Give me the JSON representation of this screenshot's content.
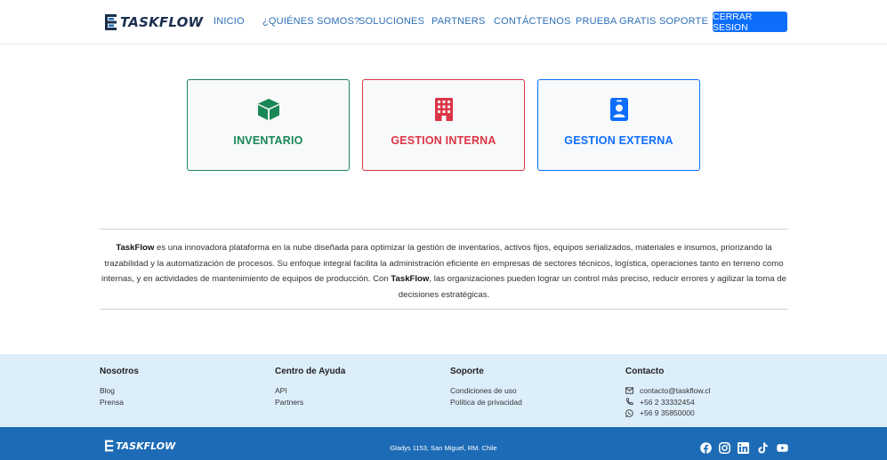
{
  "brand": {
    "name": "TASKFLOW"
  },
  "nav": {
    "items": [
      {
        "label": "INICIO"
      },
      {
        "label": "¿QUIÉNES SOMOS?"
      },
      {
        "label": "SOLUCIONES"
      },
      {
        "label": "PARTNERS"
      },
      {
        "label": "CONTÁCTENOS"
      },
      {
        "label": "PRUEBA GRATIS"
      },
      {
        "label": "SOPORTE"
      }
    ],
    "logout_label": "CERRAR SESION"
  },
  "modules": [
    {
      "label": "INVENTARIO",
      "icon": "box-icon",
      "color": "#198754"
    },
    {
      "label": "GESTION INTERNA",
      "icon": "building-icon",
      "color": "#dc3545"
    },
    {
      "label": "GESTION EXTERNA",
      "icon": "person-badge-icon",
      "color": "#0d6efd"
    }
  ],
  "about": {
    "brand_1": "TaskFlow",
    "text_1": " es una innovadora plataforma en la nube diseñada para optimizar la gestión de inventarios, activos fijos, equipos serializados, materiales e insumos, priorizando la trazabilidad y la automatización de procesos. Su enfoque integral facilita la administración eficiente en empresas de sectores técnicos, logística, operaciones tanto en terreno como internas, y en actividades de mantenimiento de equipos de producción. Con ",
    "brand_2": "TaskFlow",
    "text_2": ", las organizaciones pueden lograr un control más preciso, reducir errores y agilizar la toma de decisiones estratégicas."
  },
  "footer": {
    "nosotros": {
      "title": "Nosotros",
      "links": [
        "Blog",
        "Prensa"
      ]
    },
    "ayuda": {
      "title": "Centro de Ayuda",
      "links": [
        "API",
        "Partners"
      ]
    },
    "soporte": {
      "title": "Soporte",
      "links": [
        "Condiciones de uso",
        "Política de privacidad"
      ]
    },
    "contacto": {
      "title": "Contacto",
      "items": [
        {
          "icon": "envelope-icon",
          "text": "contacto@taskflow.cl"
        },
        {
          "icon": "phone-icon",
          "text": "+56 2 33332454"
        },
        {
          "icon": "whatsapp-icon",
          "text": "+56 9 35850000"
        }
      ]
    }
  },
  "bottom": {
    "address": "Gladys 1153, San Miguel, RM. Chile",
    "social": [
      "facebook-icon",
      "instagram-icon",
      "linkedin-icon",
      "tiktok-icon",
      "youtube-icon"
    ]
  },
  "colors": {
    "primary": "#0d6efd",
    "nav_link": "#2d6fb7",
    "footer_bg": "#ddeefb",
    "bottom_bar": "#1d6bb6"
  }
}
